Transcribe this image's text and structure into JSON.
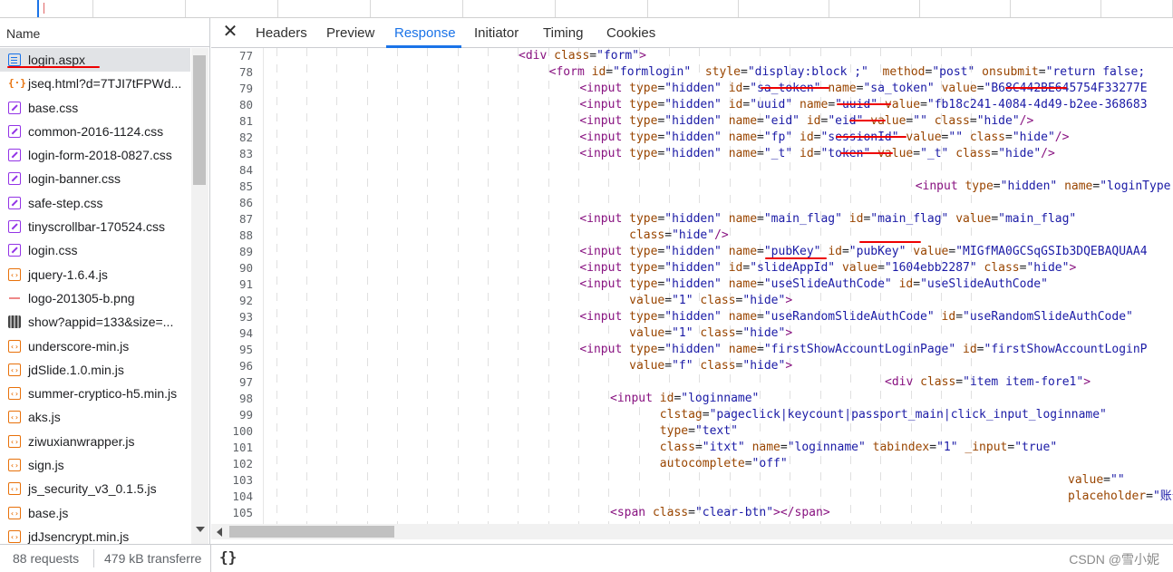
{
  "tabs": [
    {
      "label": "Headers",
      "active": false
    },
    {
      "label": "Preview",
      "active": false
    },
    {
      "label": "Response",
      "active": true
    },
    {
      "label": "Initiator",
      "active": false
    },
    {
      "label": "Timing",
      "active": false
    },
    {
      "label": "Cookies",
      "active": false
    }
  ],
  "network": {
    "name_header": "Name",
    "files": [
      {
        "name": "login.aspx",
        "icon": "document-icon",
        "type": "doc",
        "selected": true
      },
      {
        "name": "jseq.html?d=7TJI7tFPWd...",
        "icon": "xhr-icon",
        "type": "xhr"
      },
      {
        "name": "base.css",
        "icon": "css-file-icon",
        "type": "css"
      },
      {
        "name": "common-2016-1124.css",
        "icon": "css-file-icon",
        "type": "css"
      },
      {
        "name": "login-form-2018-0827.css",
        "icon": "css-file-icon",
        "type": "css"
      },
      {
        "name": "login-banner.css",
        "icon": "css-file-icon",
        "type": "css"
      },
      {
        "name": "safe-step.css",
        "icon": "css-file-icon",
        "type": "css"
      },
      {
        "name": "tinyscrollbar-170524.css",
        "icon": "css-file-icon",
        "type": "css"
      },
      {
        "name": "login.css",
        "icon": "css-file-icon",
        "type": "css"
      },
      {
        "name": "jquery-1.6.4.js",
        "icon": "js-file-icon",
        "type": "js"
      },
      {
        "name": "logo-201305-b.png",
        "icon": "image-file-icon",
        "type": "img"
      },
      {
        "name": "show?appid=133&size=...",
        "icon": "qr-image-icon",
        "type": "qr"
      },
      {
        "name": "underscore-min.js",
        "icon": "js-file-icon",
        "type": "js"
      },
      {
        "name": "jdSlide.1.0.min.js",
        "icon": "js-file-icon",
        "type": "js"
      },
      {
        "name": "summer-cryptico-h5.min.js",
        "icon": "js-file-icon",
        "type": "js"
      },
      {
        "name": "aks.js",
        "icon": "js-file-icon",
        "type": "js"
      },
      {
        "name": "ziwuxianwrapper.js",
        "icon": "js-file-icon",
        "type": "js"
      },
      {
        "name": "sign.js",
        "icon": "js-file-icon",
        "type": "js"
      },
      {
        "name": "js_security_v3_0.1.5.js",
        "icon": "js-file-icon",
        "type": "js"
      },
      {
        "name": "base.js",
        "icon": "js-file-icon",
        "type": "js"
      },
      {
        "name": "jdJsencrypt.min.js",
        "icon": "js-file-icon",
        "type": "js"
      }
    ]
  },
  "footer": {
    "requests": "88 requests",
    "transferred": "479 kB transferre",
    "format_button": "{}",
    "watermark": "CSDN @雪小妮"
  },
  "code_lines": [
    {
      "num": "77",
      "indent": 0,
      "html": "<div class=\"form\">"
    },
    {
      "num": "78",
      "indent": 1,
      "html": "<form id=\"formlogin\"  style=\"display:block ;\"  method=\"post\" onsubmit=\"return false;"
    },
    {
      "num": "79",
      "indent": 2,
      "html": "<input type=\"hidden\" id=\"sa_token\" name=\"sa_token\" value=\"B68C442BE645754F33277E"
    },
    {
      "num": "80",
      "indent": 2,
      "html": "<input type=\"hidden\" id=\"uuid\" name=\"uuid\" value=\"fb18c241-4084-4d49-b2ee-368683"
    },
    {
      "num": "81",
      "indent": 2,
      "html": "<input type=\"hidden\" name=\"eid\" id=\"eid\" value=\"\" class=\"hide\"/>"
    },
    {
      "num": "82",
      "indent": 2,
      "html": "<input type=\"hidden\" name=\"fp\" id=\"sessionId\" value=\"\" class=\"hide\"/>"
    },
    {
      "num": "83",
      "indent": 2,
      "html": "<input type=\"hidden\" name=\"_t\" id=\"token\" value=\"_t\" class=\"hide\"/>"
    },
    {
      "num": "84",
      "indent": -1,
      "html": ""
    },
    {
      "num": "85",
      "indent": 13,
      "html": "<input type=\"hidden\" name=\"loginType"
    },
    {
      "num": "86",
      "indent": -1,
      "html": ""
    },
    {
      "num": "87",
      "indent": 2,
      "html": "<input type=\"hidden\" name=\"main_flag\" id=\"main_flag\" value=\"main_flag\""
    },
    {
      "num": "88",
      "indent": 2,
      "html": "       class=\"hide\"/>"
    },
    {
      "num": "89",
      "indent": 2,
      "html": "<input type=\"hidden\" name=\"pubKey\" id=\"pubKey\" value=\"MIGfMA0GCSqGSIb3DQEBAQUAA4"
    },
    {
      "num": "90",
      "indent": 2,
      "html": "<input type=\"hidden\" id=\"slideAppId\" value=\"1604ebb2287\" class=\"hide\">"
    },
    {
      "num": "91",
      "indent": 2,
      "html": "<input type=\"hidden\" name=\"useSlideAuthCode\" id=\"useSlideAuthCode\""
    },
    {
      "num": "92",
      "indent": 2,
      "html": "       value=\"1\" class=\"hide\">"
    },
    {
      "num": "93",
      "indent": 2,
      "html": "<input type=\"hidden\" name=\"useRandomSlideAuthCode\" id=\"useRandomSlideAuthCode\""
    },
    {
      "num": "94",
      "indent": 2,
      "html": "       value=\"1\" class=\"hide\">"
    },
    {
      "num": "95",
      "indent": 2,
      "html": "<input type=\"hidden\" name=\"firstShowAccountLoginPage\" id=\"firstShowAccountLoginP"
    },
    {
      "num": "96",
      "indent": 2,
      "html": "       value=\"f\" class=\"hide\">"
    },
    {
      "num": "97",
      "indent": 12,
      "html": "<div class=\"item item-fore1\">"
    },
    {
      "num": "98",
      "indent": 3,
      "html": "<input id=\"loginname\""
    },
    {
      "num": "99",
      "indent": 3,
      "html": "       clstag=\"pageclick|keycount|passport_main|click_input_loginname\""
    },
    {
      "num": "100",
      "indent": 3,
      "html": "       type=\"text\""
    },
    {
      "num": "101",
      "indent": 3,
      "html": "       class=\"itxt\" name=\"loginname\" tabindex=\"1\" _input=\"true\""
    },
    {
      "num": "102",
      "indent": 3,
      "html": "       autocomplete=\"off\""
    },
    {
      "num": "103",
      "indent": 18,
      "html": "value=\"\""
    },
    {
      "num": "104",
      "indent": 18,
      "html": "placeholder=\"账号名/手"
    },
    {
      "num": "105",
      "indent": 3,
      "html": "<span class=\"clear-btn\"></span>"
    }
  ]
}
